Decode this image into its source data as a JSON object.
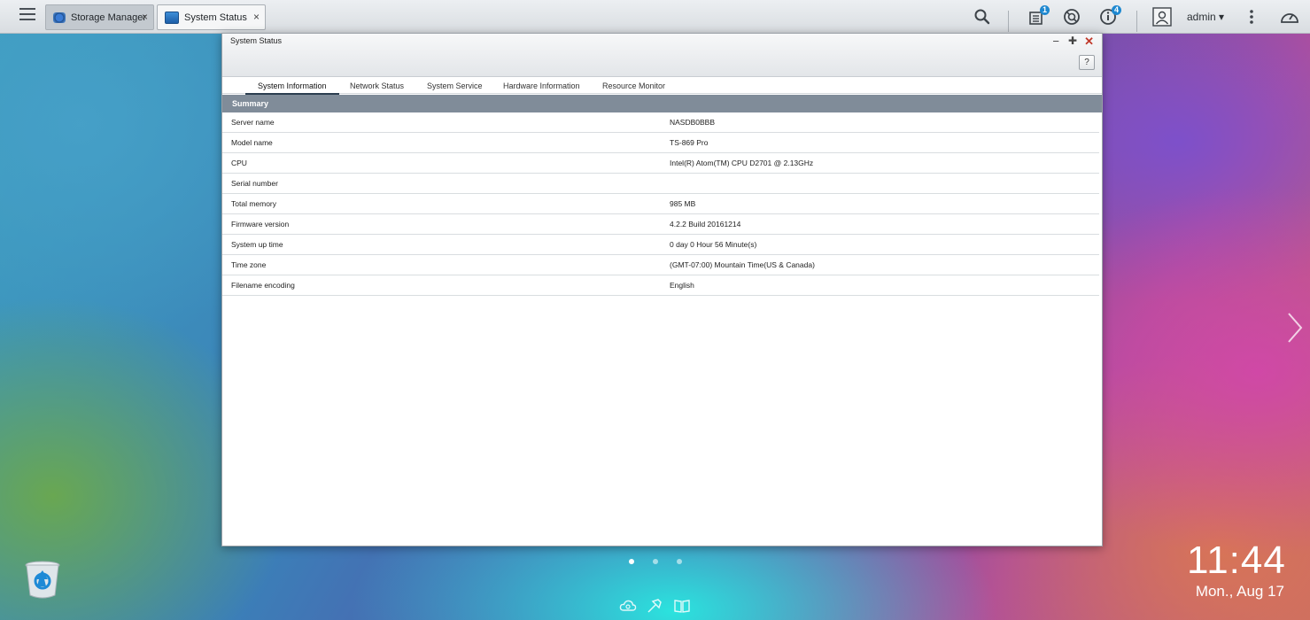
{
  "taskbar": {
    "tabs": [
      {
        "label": "Storage Manager",
        "active": false
      },
      {
        "label": "System Status",
        "active": true
      }
    ],
    "close_glyph": "×",
    "badges": {
      "notifications": "1",
      "info": "4"
    },
    "user": "admin ▾",
    "icons": [
      "menu-icon",
      "search-icon",
      "background-tasks-icon",
      "event-notification-icon",
      "info-icon",
      "user-icon",
      "more-options-icon",
      "dashboard-icon"
    ]
  },
  "window": {
    "title": "System Status",
    "controls": {
      "minimize": "−",
      "maximize": "✚",
      "close": "✕"
    },
    "help": "?",
    "tabs": [
      "System Information",
      "Network Status",
      "System Service",
      "Hardware Information",
      "Resource Monitor"
    ],
    "active_tab": "System Information",
    "section": "Summary",
    "rows": [
      {
        "key": "Server name",
        "value": "NASDB0BBB"
      },
      {
        "key": "Model name",
        "value": "TS-869 Pro"
      },
      {
        "key": "CPU",
        "value": "Intel(R) Atom(TM) CPU D2701 @ 2.13GHz"
      },
      {
        "key": "Serial number",
        "value": ""
      },
      {
        "key": "Total memory",
        "value": "985 MB"
      },
      {
        "key": "Firmware version",
        "value": "4.2.2 Build 20161214"
      },
      {
        "key": "System up time",
        "value": "0 day 0 Hour 56 Minute(s)"
      },
      {
        "key": "Time zone",
        "value": "(GMT-07:00) Mountain Time(US & Canada)"
      },
      {
        "key": "Filename encoding",
        "value": "English"
      }
    ]
  },
  "desktop": {
    "clock_time": "11:44",
    "clock_date": "Mon., Aug 17",
    "page_dots": 3,
    "active_page": 0,
    "dock_icons": [
      "myqnapcloud-icon",
      "utility-icon",
      "help-book-icon"
    ]
  },
  "colors": {
    "section_header": "#808c99",
    "badge": "#1e88d0"
  }
}
